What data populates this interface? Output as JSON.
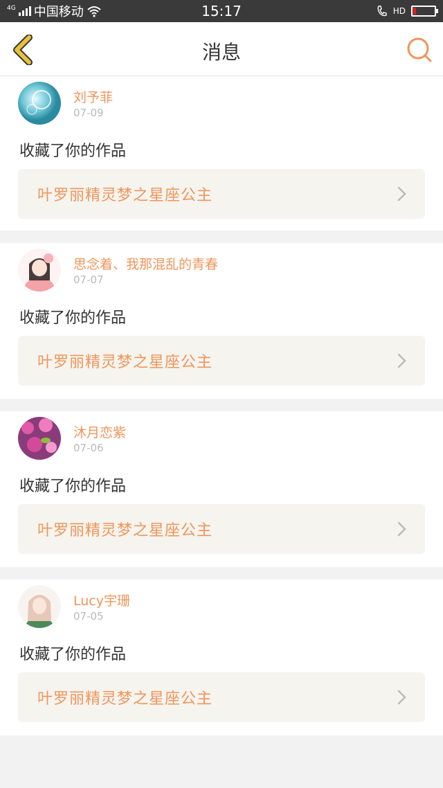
{
  "status_bar": {
    "network": "4G",
    "carrier": "中国移动",
    "time": "15:17",
    "hd": "HD",
    "battery_level": 0.12,
    "battery_color": "#e02020"
  },
  "nav": {
    "title": "消息",
    "back_icon": "chevron-left-icon",
    "search_icon": "search-icon",
    "accent": "#f0955a",
    "back_color": "#e8c23a"
  },
  "messages": [
    {
      "user": "刘予菲",
      "date": "07-09",
      "action": "收藏了你的作品",
      "work": "叶罗丽精灵梦之星座公主",
      "avatar": "avatar-bubble-icon"
    },
    {
      "user": "思念着、我那混乱的青春",
      "date": "07-07",
      "action": "收藏了你的作品",
      "work": "叶罗丽精灵梦之星座公主",
      "avatar": "avatar-anime-girl-pink-icon"
    },
    {
      "user": "沐月恋紫",
      "date": "07-06",
      "action": "收藏了你的作品",
      "work": "叶罗丽精灵梦之星座公主",
      "avatar": "avatar-blossom-bird-icon"
    },
    {
      "user": "Lucy宇珊",
      "date": "07-05",
      "action": "收藏了你的作品",
      "work": "叶罗丽精灵梦之星座公主",
      "avatar": "avatar-anime-girl-green-icon"
    }
  ]
}
